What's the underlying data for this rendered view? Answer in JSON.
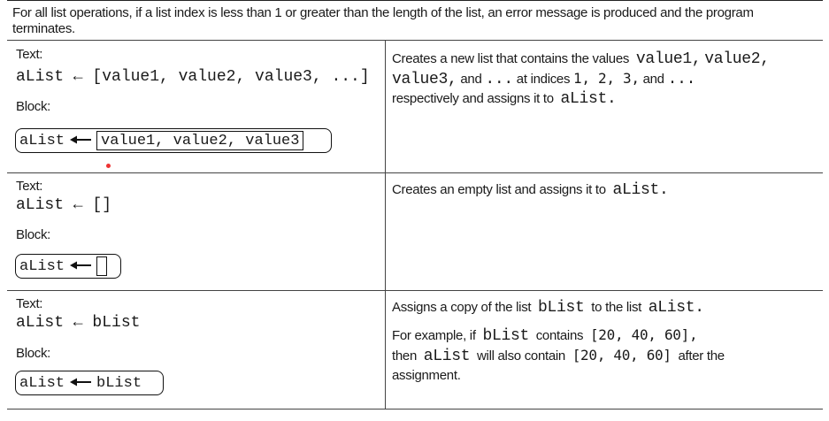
{
  "note": "For all list operations, if a list index is less than 1 or greater than the length of the list, an error message is produced and the program terminates.",
  "rows": [
    {
      "text_label": "Text:",
      "code": "aList ← [value1, value2, value3, ...]",
      "block_label": "Block:",
      "block_var": "aList",
      "block_value": "value1, value2, value3",
      "desc_parts": {
        "p1": "Creates a new list that contains the values",
        "c1": "value1,",
        "c2": "value2,",
        "c3": "value3,",
        "p2": "and",
        "c4": "...",
        "p3": "at indices",
        "c5": "1, 2, 3,",
        "p4": "and",
        "c6": "...",
        "p5": "respectively and assigns it to",
        "c7": "aList."
      }
    },
    {
      "text_label": "Text:",
      "code": "aList ← []",
      "block_label": "Block:",
      "block_var": "aList",
      "desc_p1": "Creates an empty list and assigns it to",
      "desc_c1": "aList."
    },
    {
      "text_label": "Text:",
      "code": "aList ← bList",
      "block_label": "Block:",
      "block_var": "aList",
      "block_value": "bList",
      "desc1_p1": "Assigns a copy of the list",
      "desc1_c1": "bList",
      "desc1_p2": "to the list",
      "desc1_c2": "aList.",
      "desc2_p1": "For example, if",
      "desc2_c1": "bList",
      "desc2_p2": "contains",
      "desc2_c2": "[20, 40, 60],",
      "desc2_p3": "then",
      "desc2_c3": "aList",
      "desc2_p4": "will also contain",
      "desc2_c4": "[20, 40, 60]",
      "desc2_p5": "after the",
      "desc2_p6": "assignment."
    }
  ],
  "icons": {
    "arrow": "left-arrow-icon"
  }
}
